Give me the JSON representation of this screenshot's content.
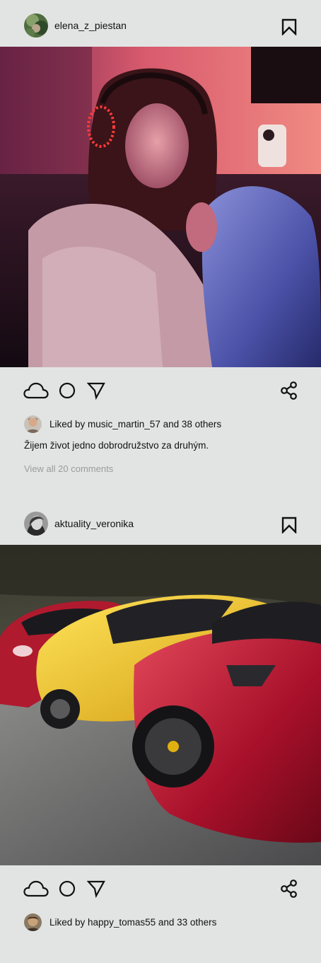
{
  "posts": [
    {
      "username": "elena_z_piestan",
      "image_icon": "portrait-photo",
      "likes_text": "Liked by music_martin_57 and 38 others",
      "caption": "Žijem život jedno dobrodružstvo za druhým.",
      "comments_link": "View all 20 comments"
    },
    {
      "username": "aktuality_veronika",
      "image_icon": "sports-cars-photo",
      "likes_text": "Liked by happy_tomas55 and 33 others"
    }
  ],
  "icons": {
    "like": "cloud-icon",
    "comment": "circle-icon",
    "send": "send-arrow-icon",
    "share": "share-icon",
    "bookmark": "bookmark-icon"
  },
  "colors": {
    "background": "#e2e4e3",
    "text": "#111111",
    "muted": "#9a9c9b"
  }
}
